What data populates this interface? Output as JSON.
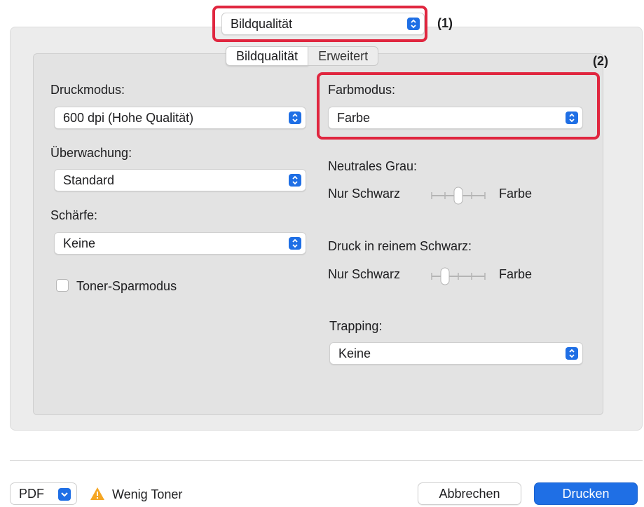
{
  "top_select": {
    "value": "Bildqualität"
  },
  "annotations": {
    "one": "(1)",
    "two": "(2)"
  },
  "tabs": [
    {
      "label": "Bildqualität",
      "active": true
    },
    {
      "label": "Erweitert",
      "active": false
    }
  ],
  "left": {
    "druckmodus": {
      "label": "Druckmodus:",
      "value": "600 dpi (Hohe Qualität)"
    },
    "ueberwachung": {
      "label": "Überwachung:",
      "value": "Standard"
    },
    "schaerfe": {
      "label": "Schärfe:",
      "value": "Keine"
    },
    "toner": {
      "label": "Toner-Sparmodus",
      "checked": false
    }
  },
  "right": {
    "farbmodus": {
      "label": "Farbmodus:",
      "value": "Farbe"
    },
    "neutrales_grau": {
      "label": "Neutrales Grau:",
      "min_label": "Nur Schwarz",
      "max_label": "Farbe",
      "level_percent": 50
    },
    "reines_schwarz": {
      "label": "Druck in reinem Schwarz:",
      "min_label": "Nur Schwarz",
      "max_label": "Farbe",
      "level_percent": 25
    },
    "trapping": {
      "label": "Trapping:",
      "value": "Keine"
    }
  },
  "footer": {
    "pdf_label": "PDF",
    "warning_text": "Wenig Toner",
    "cancel_label": "Abbrechen",
    "print_label": "Drucken"
  },
  "colors": {
    "accent": "#1f6fe5",
    "highlight": "#e0263f",
    "warning": "#f5a623"
  },
  "icons": [
    "chevron-updown-icon",
    "chevron-down-icon",
    "warning-triangle-icon"
  ]
}
